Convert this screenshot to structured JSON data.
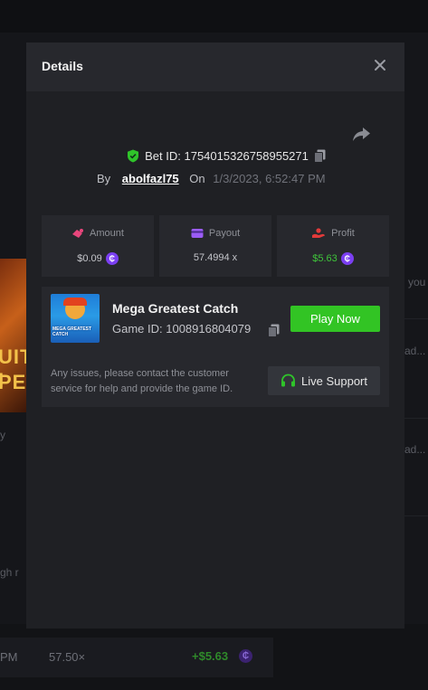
{
  "background": {
    "frag_right_1": "you",
    "frag_right_2": "ad...",
    "frag_right_3": "ad...",
    "frag_left_1": "y",
    "frag_left_2": "gh r",
    "promo_line_1": "UIT I",
    "promo_line_2": "PER",
    "bottom_row": {
      "time": "PM",
      "multiplier": "57.50×",
      "profit": "+$5.63",
      "coin_symbol": "₵"
    }
  },
  "modal": {
    "title": "Details",
    "bet_id_label": "Bet ID: 1754015326758955271",
    "by_label": "By",
    "username": "abolfazl75",
    "on_label": "On",
    "date": "1/3/2023, 6:52:47 PM",
    "stats": {
      "amount_label": "Amount",
      "amount_value": "$0.09",
      "payout_label": "Payout",
      "payout_value": "57.4994 x",
      "profit_label": "Profit",
      "profit_value": "$5.63",
      "coin_symbol": "₵"
    },
    "game": {
      "thumb_text": "MEGA GREATEST CATCH",
      "title": "Mega Greatest Catch",
      "id_label": "Game ID: 1008916804079",
      "play_button": "Play Now",
      "help_text": "Any issues, please contact the customer service for help and provide the game ID.",
      "support_button": "Live Support"
    }
  },
  "colors": {
    "accent_green": "#32c424",
    "profit_green": "#3fc53a",
    "coin_purple": "#7b3ff2",
    "amount_icon": "#e8467c",
    "payout_icon": "#9b5cf6",
    "profit_icon": "#e23a3a"
  }
}
